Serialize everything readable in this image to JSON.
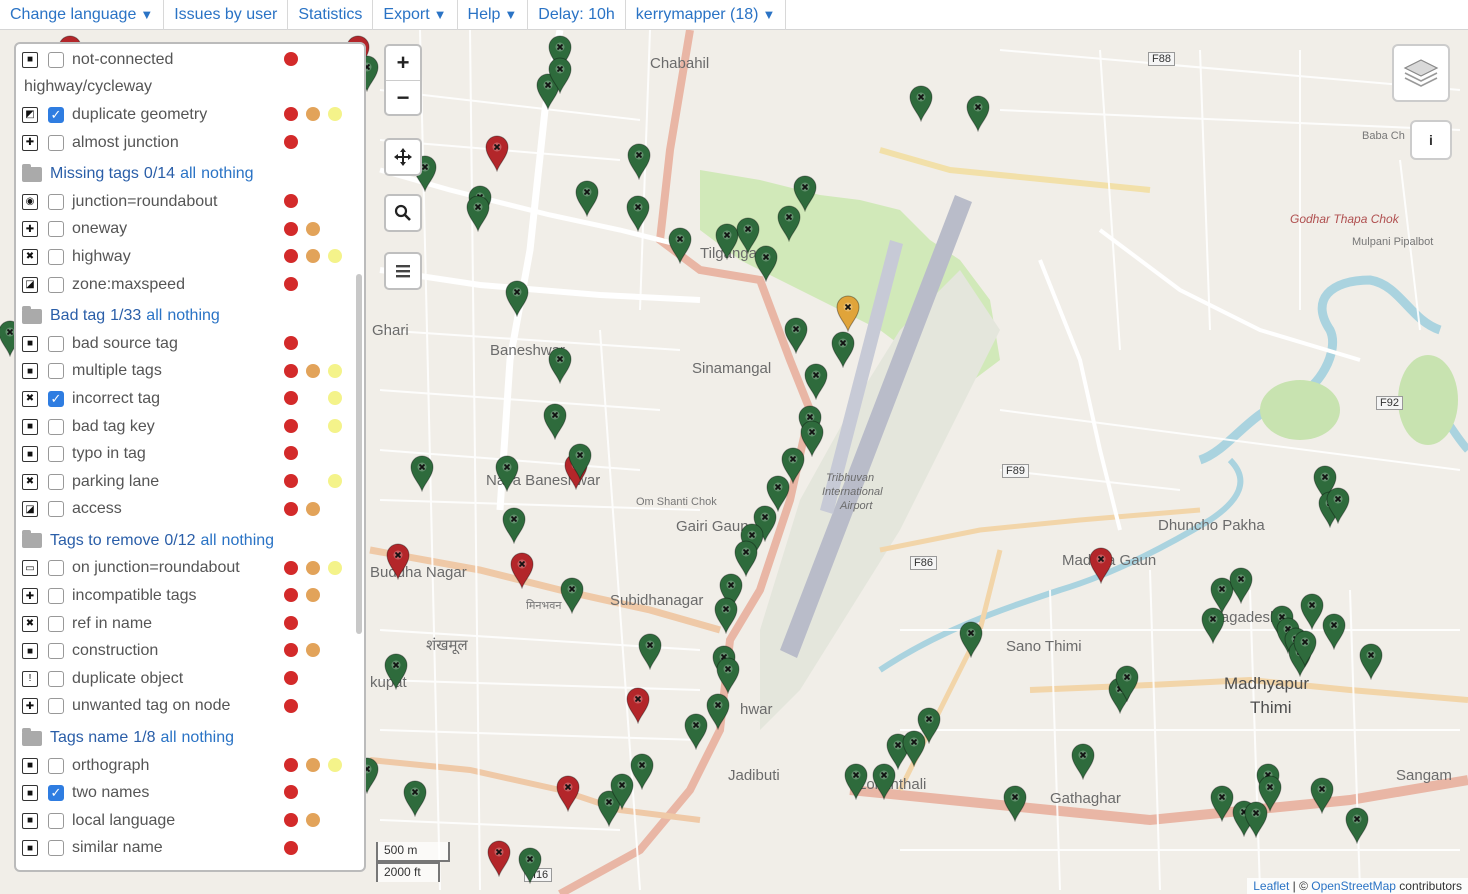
{
  "menu": {
    "change_language": "Change language",
    "issues_by_user": "Issues by user",
    "statistics": "Statistics",
    "export": "Export",
    "help": "Help",
    "delay": "Delay: 10h",
    "user": "kerrymapper (18)"
  },
  "controls": {
    "zoom_in": "+",
    "zoom_out": "−",
    "info": "i"
  },
  "scale": {
    "metric": "500 m",
    "imperial": "2000 ft"
  },
  "attribution": {
    "leaflet": "Leaflet",
    "separator": " | © ",
    "osm": "OpenStreetMap",
    "contributors": " contributors"
  },
  "panel": {
    "top_items": [
      {
        "label": "not-connected",
        "checked": false,
        "icon": "■",
        "dots": [
          "red"
        ]
      },
      {
        "label": "highway/cycleway",
        "plain": true
      },
      {
        "label": "duplicate geometry",
        "checked": true,
        "icon": "◩",
        "dots": [
          "red",
          "orange",
          "yellow"
        ]
      },
      {
        "label": "almost junction",
        "checked": false,
        "icon": "✚",
        "dots": [
          "red"
        ]
      }
    ],
    "groups": [
      {
        "title": "Missing tags",
        "count": "0/14",
        "all": "all",
        "nothing": "nothing",
        "items": [
          {
            "label": "junction=roundabout",
            "checked": false,
            "icon": "◉",
            "dots": [
              "red"
            ]
          },
          {
            "label": "oneway",
            "checked": false,
            "icon": "✚",
            "dots": [
              "red",
              "orange"
            ]
          },
          {
            "label": "highway",
            "checked": false,
            "icon": "✖",
            "dots": [
              "red",
              "orange",
              "yellow"
            ]
          },
          {
            "label": "zone:maxspeed",
            "checked": false,
            "icon": "◪",
            "dots": [
              "red"
            ]
          }
        ]
      },
      {
        "title": "Bad tag",
        "count": "1/33",
        "all": "all",
        "nothing": "nothing",
        "items": [
          {
            "label": "bad source tag",
            "checked": false,
            "icon": "■",
            "dots": [
              "red"
            ]
          },
          {
            "label": "multiple tags",
            "checked": false,
            "icon": "■",
            "dots": [
              "red",
              "orange",
              "yellow"
            ]
          },
          {
            "label": "incorrect tag",
            "checked": true,
            "icon": "✖",
            "dots": [
              "red",
              "yellow-2"
            ]
          },
          {
            "label": "bad tag key",
            "checked": false,
            "icon": "■",
            "dots": [
              "red",
              "yellow-2"
            ]
          },
          {
            "label": "typo in tag",
            "checked": false,
            "icon": "■",
            "dots": [
              "red"
            ]
          },
          {
            "label": "parking lane",
            "checked": false,
            "icon": "✖",
            "dots": [
              "red",
              "yellow-2"
            ]
          },
          {
            "label": "access",
            "checked": false,
            "icon": "◪",
            "dots": [
              "red",
              "orange"
            ]
          }
        ]
      },
      {
        "title": "Tags to remove",
        "count": "0/12",
        "all": "all",
        "nothing": "nothing",
        "items": [
          {
            "label": "on junction=roundabout",
            "checked": false,
            "icon": "▭",
            "dots": [
              "red",
              "orange",
              "yellow"
            ]
          },
          {
            "label": "incompatible tags",
            "checked": false,
            "icon": "✚",
            "dots": [
              "red",
              "orange"
            ]
          },
          {
            "label": "ref in name",
            "checked": false,
            "icon": "✖",
            "dots": [
              "red"
            ]
          },
          {
            "label": "construction",
            "checked": false,
            "icon": "■",
            "dots": [
              "red",
              "orange"
            ]
          },
          {
            "label": "duplicate object",
            "checked": false,
            "icon": "!",
            "dots": [
              "red"
            ]
          },
          {
            "label": "unwanted tag on node",
            "checked": false,
            "icon": "✚",
            "dots": [
              "red"
            ]
          }
        ]
      },
      {
        "title": "Tags name",
        "count": "1/8",
        "all": "all",
        "nothing": "nothing",
        "items": [
          {
            "label": "orthograph",
            "checked": false,
            "icon": "■",
            "dots": [
              "red",
              "orange",
              "yellow"
            ]
          },
          {
            "label": "two names",
            "checked": true,
            "icon": "■",
            "dots": [
              "red"
            ]
          },
          {
            "label": "local language",
            "checked": false,
            "icon": "■",
            "dots": [
              "red",
              "orange"
            ]
          },
          {
            "label": "similar name",
            "checked": false,
            "icon": "■",
            "dots": [
              "red"
            ]
          }
        ]
      }
    ]
  },
  "map_labels": {
    "chabahil": "Chabahil",
    "tilganga": "Tilganga",
    "ghari": "Ghari",
    "baneshwar": "Baneshwar",
    "sinamangal": "Sinamangal",
    "naya_baneshwar": "Naya Baneshwar",
    "om_shanti_chok": "Om Shanti Chok",
    "gairi_gaun": "Gairi Gaun",
    "buddha_nagar": "Buddha Nagar",
    "subidhanagar": "Subidhanagar",
    "devanagari_1": "मिनभवन",
    "devanagari_2": "शंखमूल",
    "kupat": "kupat",
    "jadibuti": "Jadibuti",
    "koteshwar": "hwar",
    "lokanthali": "Lokanthali",
    "gathaghar": "Gathaghar",
    "sano_thimi": "Sano Thimi",
    "madhyapur_thimi_1": "Madhyapur",
    "madhyapur_thimi_2": "Thimi",
    "nagadesh": "Nagadesh",
    "dhuncho_pakha": "Dhuncho Pakha",
    "madhya_gaun": "Madhya Gaun",
    "sangam": "Sangam",
    "airport_1": "Tribhuvan",
    "airport_2": "International",
    "airport_3": "Airport",
    "godhar_thapa_chok": "Godhar Thapa Chok",
    "mulpani_pipalbot": "Mulpani Pipalbot",
    "baba_ch": "Baba Ch",
    "f88": "F88",
    "f89": "F89",
    "f86": "F86",
    "f92": "F92",
    "h16": "H16"
  },
  "colors": {
    "marker_green": "#2e6b3c",
    "marker_red": "#b3262a",
    "marker_orange": "#e0a43a",
    "menu_link": "#2a73c5",
    "checkbox_checked": "#2f7de1"
  }
}
